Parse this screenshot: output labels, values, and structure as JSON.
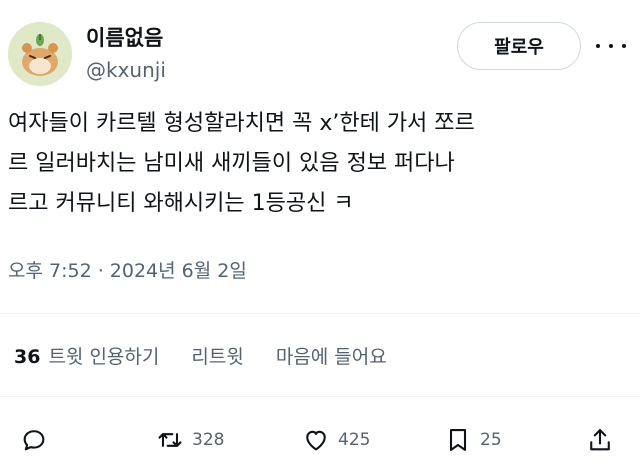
{
  "author": {
    "display_name": "이름없음",
    "handle": "@kxunji",
    "avatar": "hamster-avatar"
  },
  "header": {
    "follow_label": "팔로우",
    "more_icon": "more-icon"
  },
  "tweet": {
    "lines": [
      "여자들이 카르텔 형성할라치면 꼭 x’한테 가서 쪼르",
      "르 일러바치는 남미새 새끼들이 있음 정보 퍼다나",
      "르고 커뮤니티 와해시키는 1등공신 ㅋ"
    ],
    "timestamp": "오후 7:52 · 2024년 6월 2일"
  },
  "stats": {
    "quote_count": "36",
    "quote_label": "트윗 인용하기",
    "retweets_label": "리트윗",
    "likes_label": "마음에 들어요"
  },
  "actions": {
    "reply_icon": "reply-icon",
    "retweet_icon": "retweet-icon",
    "retweet_count": "328",
    "like_icon": "heart-icon",
    "like_count": "425",
    "bookmark_icon": "bookmark-icon",
    "bookmark_count": "25",
    "share_icon": "share-icon"
  },
  "colors": {
    "text": "#0f1419",
    "secondary": "#536471",
    "border": "#cfd9de",
    "divider": "#eff3f4",
    "avatar_bg": "#dfe9c8"
  }
}
